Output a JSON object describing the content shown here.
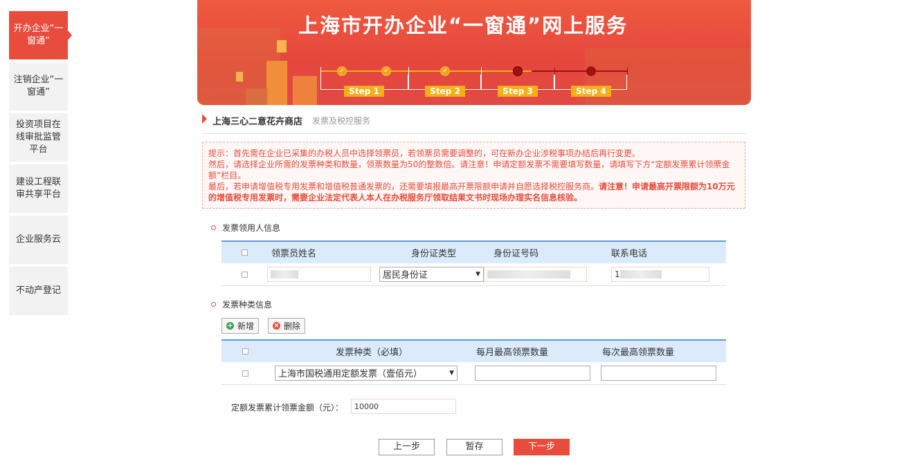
{
  "sidebar": {
    "items": [
      {
        "label": "开办企业“一窗通”",
        "active": true
      },
      {
        "label": "注销企业“一窗通”",
        "active": false
      },
      {
        "label": "投资项目在线审批监管平台",
        "active": false
      },
      {
        "label": "建设工程联审共享平台",
        "active": false
      },
      {
        "label": "企业服务云",
        "active": false
      },
      {
        "label": "不动产登记",
        "active": false
      }
    ]
  },
  "banner": {
    "title": "上海市开办企业“一窗通”网上服务",
    "steps": [
      "Step 1",
      "Step 2",
      "Step 3",
      "Step 4"
    ]
  },
  "company": {
    "name": "上海三心二意花卉商店",
    "subtitle": "发票及税控服务"
  },
  "notice": {
    "line1": "提示：首先需在企业已采集的办税人员中选择领票员，若领票员需要调整的，可在新办企业涉税事项办结后再行变更。",
    "line2": "然后，请选择企业所需的发票种类和数量，领票数量为50的整数倍。请注意！申请定额发票不需要填写数量，请填写下方“定额发票累计领票金额”栏目。",
    "line3_normal": "最后，若申请增值税专用发票和增值税普通发票的，还需要填报最高开票限额申请并自愿选择税控服务商。",
    "line3_bold": "请注意！申请最高开票限额为10万元的增值税专用发票时，需要企业法定代表人本人在办税服务厅领取结果文书时现场办理实名信息核验。"
  },
  "receiver_section": {
    "title": "发票领用人信息",
    "headers": [
      "领票员姓名",
      "身份证类型",
      "身份证号码",
      "联系电话"
    ],
    "row": {
      "name": "",
      "id_type": "居民身份证",
      "id_number": "",
      "phone": "1"
    }
  },
  "invoice_section": {
    "title": "发票种类信息",
    "add_label": "新增",
    "delete_label": "删除",
    "headers": [
      "发票种类（必填）",
      "每月最高领票数量",
      "每次最高领票数量"
    ],
    "row": {
      "type": "上海市国税通用定额发票（壹佰元）",
      "monthly_max": "",
      "per_time_max": ""
    }
  },
  "total": {
    "label": "定额发票累计领票金额（元）：",
    "value": "10000"
  },
  "footer": {
    "prev": "上一步",
    "save": "暂存",
    "next": "下一步"
  },
  "colors": {
    "accent": "#e84c3d",
    "step_done": "#f1a31a",
    "step_current": "#a1110f",
    "table_header": "#dcebfb"
  }
}
